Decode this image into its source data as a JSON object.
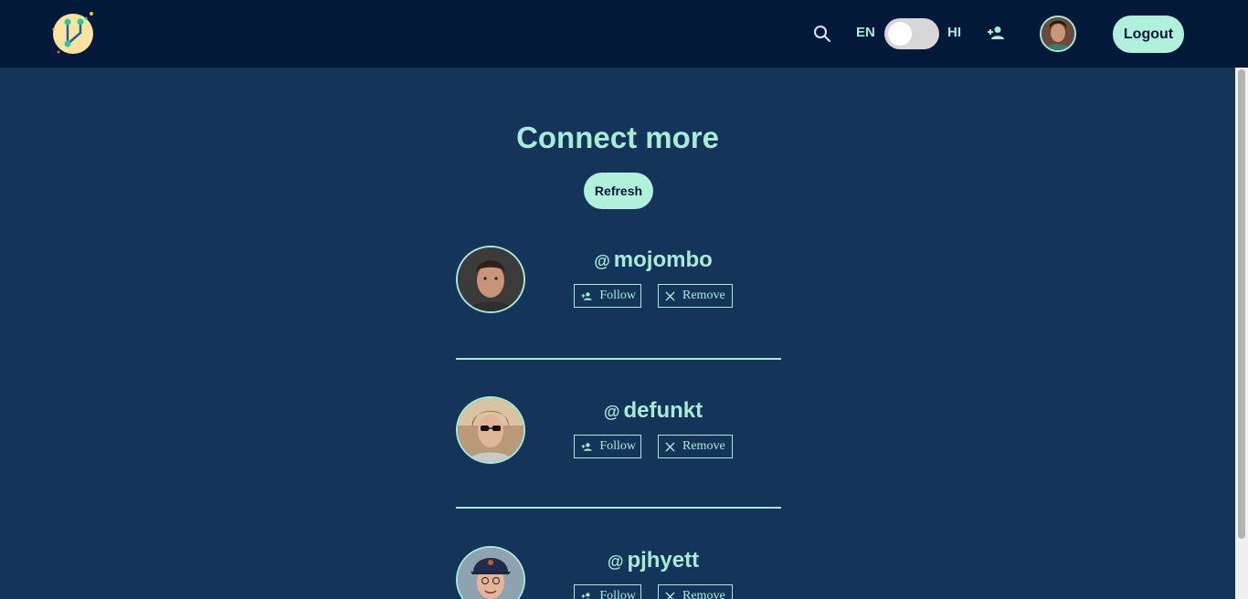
{
  "header": {
    "lang_left": "EN",
    "lang_right": "HI",
    "logout_label": "Logout",
    "accent_color": "#b1f1dc",
    "background_color": "#03193a"
  },
  "main": {
    "title": "Connect more",
    "refresh_label": "Refresh",
    "background_color": "#14345a",
    "suggestions": [
      {
        "at": "@",
        "username": "mojombo",
        "follow_label": "Follow",
        "remove_label": "Remove"
      },
      {
        "at": "@",
        "username": "defunkt",
        "follow_label": "Follow",
        "remove_label": "Remove"
      },
      {
        "at": "@",
        "username": "pjhyett",
        "follow_label": "Follow",
        "remove_label": "Remove"
      }
    ]
  },
  "icons": {
    "search": "search-icon",
    "add_user": "person-add-icon",
    "follow": "person-add-icon",
    "remove": "close-icon"
  }
}
